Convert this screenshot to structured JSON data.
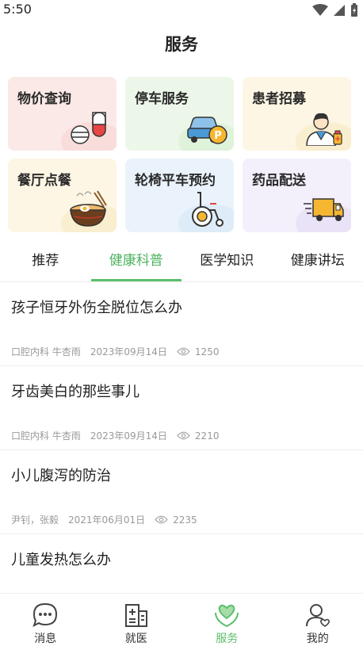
{
  "status_bar": {
    "time": "5:50"
  },
  "header": {
    "title": "服务"
  },
  "services": [
    {
      "label": "物价查询",
      "icon": "pill-icon",
      "theme": "pink"
    },
    {
      "label": "停车服务",
      "icon": "car-parking-icon",
      "theme": "green"
    },
    {
      "label": "患者招募",
      "icon": "doctor-icon",
      "theme": "yellow"
    },
    {
      "label": "餐厅点餐",
      "icon": "food-bowl-icon",
      "theme": "yellow"
    },
    {
      "label": "轮椅平车预约",
      "icon": "wheelchair-icon",
      "theme": "blue"
    },
    {
      "label": "药品配送",
      "icon": "delivery-truck-icon",
      "theme": "purple"
    }
  ],
  "tabs": [
    {
      "label": "推荐"
    },
    {
      "label": "健康科普",
      "active": true
    },
    {
      "label": "医学知识"
    },
    {
      "label": "健康讲坛"
    }
  ],
  "articles": [
    {
      "title": "孩子恒牙外伤全脱位怎么办",
      "author": "口腔内科 牛杏雨",
      "date": "2023年09月14日",
      "views": "1250"
    },
    {
      "title": "牙齿美白的那些事儿",
      "author": "口腔内科 牛杏雨",
      "date": "2023年09月14日",
      "views": "2210"
    },
    {
      "title": "小儿腹泻的防治",
      "author": "尹钊，张毅",
      "date": "2021年06月01日",
      "views": "2235"
    },
    {
      "title": "儿童发热怎么办",
      "author": "",
      "date": "",
      "views": ""
    }
  ],
  "bottom_nav": [
    {
      "label": "消息",
      "icon": "message-icon"
    },
    {
      "label": "就医",
      "icon": "hospital-icon"
    },
    {
      "label": "服务",
      "icon": "heart-hands-icon",
      "active": true
    },
    {
      "label": "我的",
      "icon": "user-icon"
    }
  ],
  "colors": {
    "accent": "#5cbf6a",
    "text": "#222222",
    "muted": "#999999"
  }
}
